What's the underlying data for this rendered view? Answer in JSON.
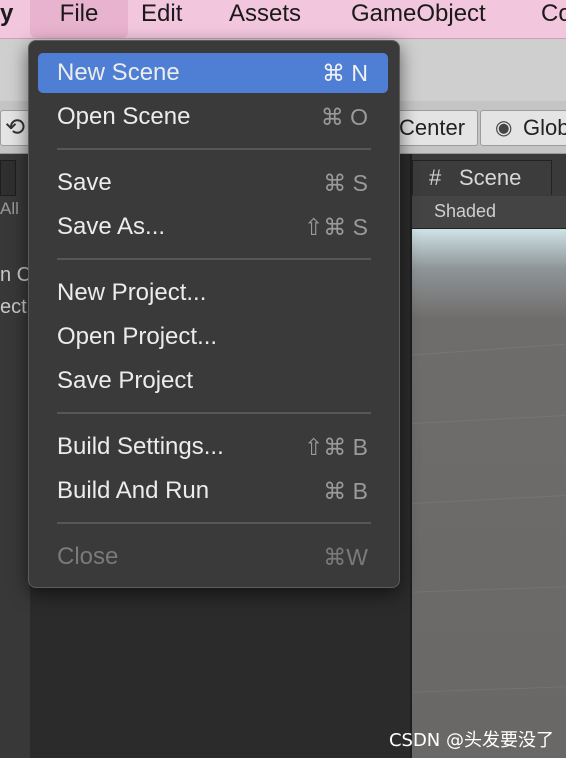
{
  "menubar": {
    "app_partial": "y",
    "items": [
      "File",
      "Edit",
      "Assets",
      "GameObject",
      "Co"
    ]
  },
  "toolbar": {
    "pivot_partial": "Center",
    "global_partial": "Glob"
  },
  "left_panel": {
    "search_partial": "All",
    "row1_partial": "n C",
    "row2_partial": "ect"
  },
  "scene": {
    "tab_label": "Scene",
    "shading_mode": "Shaded"
  },
  "file_menu": {
    "items": [
      {
        "label": "New Scene",
        "shortcut": "⌘ N",
        "highlighted": true
      },
      {
        "label": "Open Scene",
        "shortcut": "⌘ O"
      },
      {
        "label": "Save",
        "shortcut": "⌘ S"
      },
      {
        "label": "Save As...",
        "shortcut": "⇧⌘ S"
      },
      {
        "label": "New Project...",
        "shortcut": ""
      },
      {
        "label": "Open Project...",
        "shortcut": ""
      },
      {
        "label": "Save Project",
        "shortcut": ""
      },
      {
        "label": "Build Settings...",
        "shortcut": "⇧⌘ B"
      },
      {
        "label": "Build And Run",
        "shortcut": "⌘ B"
      },
      {
        "label": "Close",
        "shortcut": "⌘W",
        "disabled": true
      }
    ]
  },
  "watermark": "CSDN @头发要没了"
}
